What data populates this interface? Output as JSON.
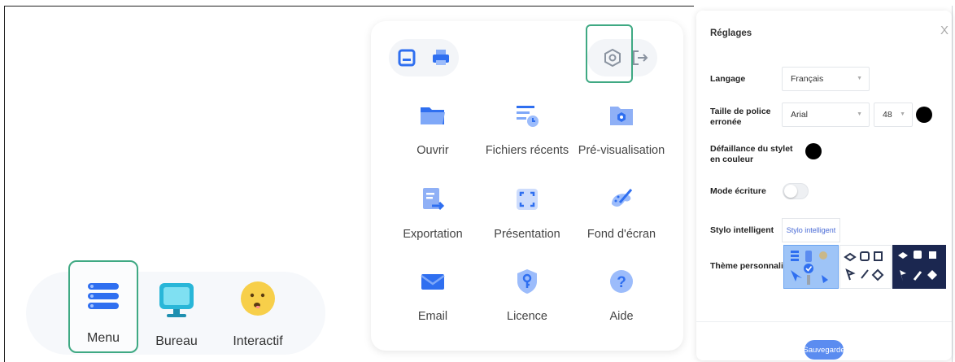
{
  "toolbar": {
    "items": [
      {
        "label": "Menu",
        "icon": "menu-icon",
        "selected": true
      },
      {
        "label": "Bureau",
        "icon": "monitor-icon"
      },
      {
        "label": "Interactif",
        "icon": "emoji-face-icon"
      }
    ]
  },
  "menu_panel": {
    "top_buttons": [
      "save-icon",
      "print-icon",
      "settings-icon",
      "exit-icon"
    ],
    "items": [
      {
        "label": "Ouvrir",
        "icon": "folder-icon"
      },
      {
        "label": "Fichiers récents",
        "icon": "recent-files-icon"
      },
      {
        "label": "Pré-visualisation",
        "icon": "preview-icon"
      },
      {
        "label": "Exportation",
        "icon": "export-icon"
      },
      {
        "label": "Présentation",
        "icon": "presentation-icon"
      },
      {
        "label": "Fond d'écran",
        "icon": "wallpaper-icon"
      },
      {
        "label": "Email",
        "icon": "email-icon"
      },
      {
        "label": "Licence",
        "icon": "license-icon"
      },
      {
        "label": "Aide",
        "icon": "help-icon"
      }
    ]
  },
  "settings": {
    "title": "Réglages",
    "close": "X",
    "language": {
      "label": "Langage",
      "value": "Français"
    },
    "font": {
      "label_line1": "Taille de police",
      "label_line2": "erronée",
      "family": "Arial",
      "size": "48",
      "color": "#000000"
    },
    "pen_color": {
      "label_line1": "Défaillance du stylet",
      "label_line2": "en couleur",
      "color": "#000000"
    },
    "writing_mode": {
      "label": "Mode écriture",
      "enabled": false
    },
    "smart_pen": {
      "label": "Stylo intelligent",
      "button": "Stylo intelligent"
    },
    "theme": {
      "label": "Thème personnalisé",
      "options": [
        "blue",
        "white",
        "dark-navy"
      ],
      "selected": "blue"
    },
    "save_label": "Sauvegarde"
  },
  "colors": {
    "accent_green": "#3fa983",
    "primary_blue": "#4f86f7",
    "save_blue": "#5b8cf0"
  }
}
